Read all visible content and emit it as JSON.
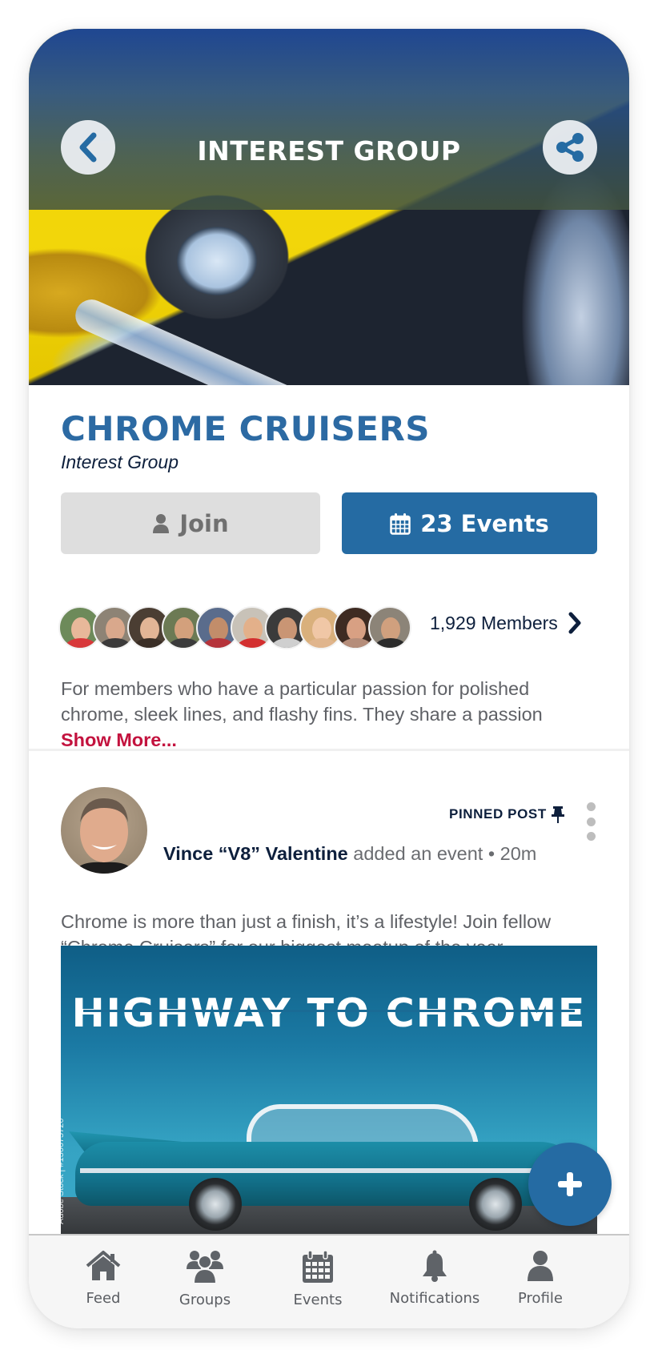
{
  "header": {
    "title": "INTEREST GROUP",
    "back_icon": "chevron-left-icon",
    "share_icon": "share-icon"
  },
  "group": {
    "name": "CHROME CRUISERS",
    "type": "Interest Group",
    "join_label": "Join",
    "events_label": "23 Events",
    "members_label": "1,929 Members",
    "member_avatar_count": 10,
    "description": "For members who have a particular passion for polished chrome, sleek lines, and flashy fins. They share a passion",
    "show_more_label": "Show More..."
  },
  "post": {
    "pinned_label": "PINNED POST",
    "author": "Vince “V8” Valentine",
    "action": " added an event",
    "separator": " • ",
    "time": "20m",
    "text": "Chrome is more than just a finish, it’s a lifestyle! Join fellow “Chrome Cruisers” for our biggest meetup of the year.",
    "image_title": "HIGHWAY TO CHROME",
    "image_watermark": "Adobe Stock | #136675720"
  },
  "fab": {
    "icon": "plus-icon"
  },
  "bottom_nav": {
    "items": [
      {
        "label": "Feed",
        "icon": "home-icon"
      },
      {
        "label": "Groups",
        "icon": "groups-icon"
      },
      {
        "label": "Events",
        "icon": "calendar-icon"
      },
      {
        "label": "Notifications",
        "icon": "bell-icon"
      },
      {
        "label": "Profile",
        "icon": "user-icon"
      }
    ]
  },
  "colors": {
    "brand_blue": "#256ba3",
    "title_blue": "#2c6aa3",
    "navy": "#0d1f3c",
    "accent_red": "#c3123e",
    "nav_gray": "#5a5d62"
  }
}
